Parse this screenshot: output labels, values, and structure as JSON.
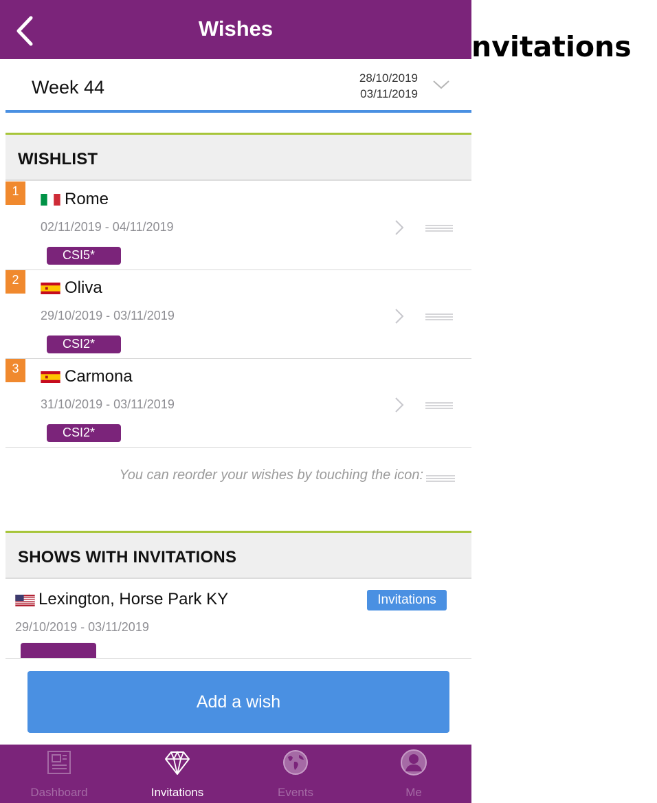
{
  "stray_title": "nvitations",
  "header": {
    "title": "Wishes"
  },
  "week": {
    "label": "Week 44",
    "start": "28/10/2019",
    "end": "03/11/2019"
  },
  "wishlist": {
    "title": "WISHLIST",
    "items": [
      {
        "rank": "1",
        "country": "Italy",
        "city": "Rome",
        "dates": "02/11/2019 - 04/11/2019",
        "level": "CSI5*"
      },
      {
        "rank": "2",
        "country": "Spain",
        "city": "Oliva",
        "dates": "29/10/2019 - 03/11/2019",
        "level": "CSI2*"
      },
      {
        "rank": "3",
        "country": "Spain",
        "city": "Carmona",
        "dates": "31/10/2019 - 03/11/2019",
        "level": "CSI2*"
      }
    ],
    "hint": "You can reorder your wishes by touching the icon:"
  },
  "shows": {
    "title": "SHOWS WITH INVITATIONS",
    "items": [
      {
        "country": "USA",
        "city": "Lexington, Horse Park KY",
        "badge": "Invitations",
        "dates": "29/10/2019 - 03/11/2019"
      }
    ]
  },
  "add_button": "Add a wish",
  "tabs": [
    {
      "label": "Dashboard",
      "icon": "newspaper-icon",
      "active": false
    },
    {
      "label": "Invitations",
      "icon": "diamond-icon",
      "active": true
    },
    {
      "label": "Events",
      "icon": "globe-icon",
      "active": false
    },
    {
      "label": "Me",
      "icon": "user-icon",
      "active": false
    }
  ],
  "colors": {
    "primary": "#7b247a",
    "accent_blue": "#4a90e2",
    "section_line": "#a7c53a",
    "rank_orange": "#f0892e"
  }
}
